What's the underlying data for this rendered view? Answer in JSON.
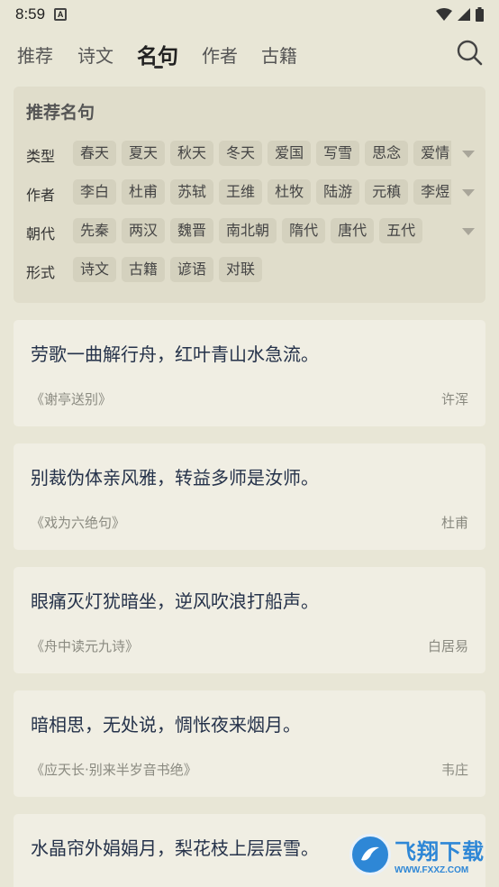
{
  "status_bar": {
    "time": "8:59",
    "notif_letter": "A"
  },
  "tabs": [
    {
      "label": "推荐"
    },
    {
      "label": "诗文"
    },
    {
      "label": "名句"
    },
    {
      "label": "作者"
    },
    {
      "label": "古籍"
    }
  ],
  "active_tab": "名句",
  "filter": {
    "title": "推荐名句",
    "rows": [
      {
        "label": "类型",
        "chips": [
          "春天",
          "夏天",
          "秋天",
          "冬天",
          "爱国",
          "写雪",
          "思念",
          "爱情"
        ]
      },
      {
        "label": "作者",
        "chips": [
          "李白",
          "杜甫",
          "苏轼",
          "王维",
          "杜牧",
          "陆游",
          "元稹",
          "李煜"
        ]
      },
      {
        "label": "朝代",
        "chips": [
          "先秦",
          "两汉",
          "魏晋",
          "南北朝",
          "隋代",
          "唐代",
          "五代"
        ]
      },
      {
        "label": "形式",
        "chips": [
          "诗文",
          "古籍",
          "谚语",
          "对联"
        ]
      }
    ]
  },
  "quotes": [
    {
      "text": "劳歌一曲解行舟，红叶青山水急流。",
      "source": "《谢亭送别》",
      "author": "许浑"
    },
    {
      "text": "别裁伪体亲风雅，转益多师是汝师。",
      "source": "《戏为六绝句》",
      "author": "杜甫"
    },
    {
      "text": "眼痛灭灯犹暗坐，逆风吹浪打船声。",
      "source": "《舟中读元九诗》",
      "author": "白居易"
    },
    {
      "text": "暗相思，无处说，惆怅夜来烟月。",
      "source": "《应天长·别来半岁音书绝》",
      "author": "韦庄"
    },
    {
      "text": "水晶帘外娟娟月，梨花枝上层层雪。",
      "source": "",
      "author": ""
    }
  ],
  "watermark": {
    "main": "飞翔下载",
    "sub": "WWW.FXXZ.COM"
  },
  "colors": {
    "background": "#e8e6d6",
    "card": "#f0eee3",
    "quote_text": "#25324a",
    "chip": "#d4d1be"
  }
}
